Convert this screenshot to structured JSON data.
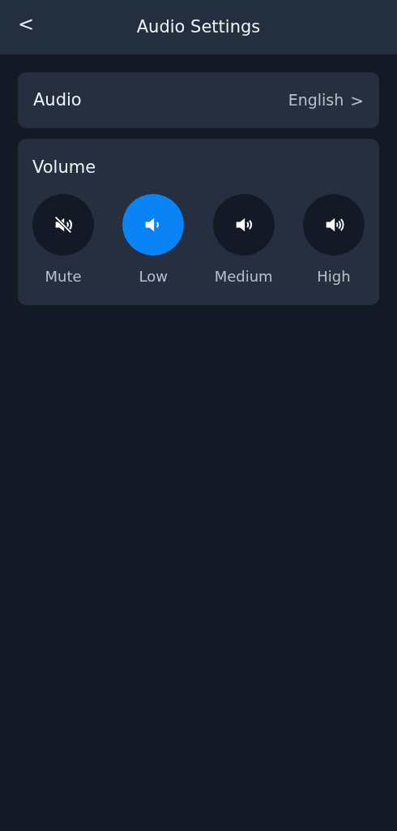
{
  "header": {
    "back": "<",
    "title": "Audio Settings"
  },
  "audio_row": {
    "label": "Audio",
    "value": "English",
    "chevron": ">"
  },
  "volume": {
    "title": "Volume",
    "options": [
      {
        "kind": "mute",
        "label": "Mute",
        "selected": false
      },
      {
        "kind": "low",
        "label": "Low",
        "selected": true
      },
      {
        "kind": "medium",
        "label": "Medium",
        "selected": false
      },
      {
        "kind": "high",
        "label": "High",
        "selected": false
      }
    ]
  }
}
